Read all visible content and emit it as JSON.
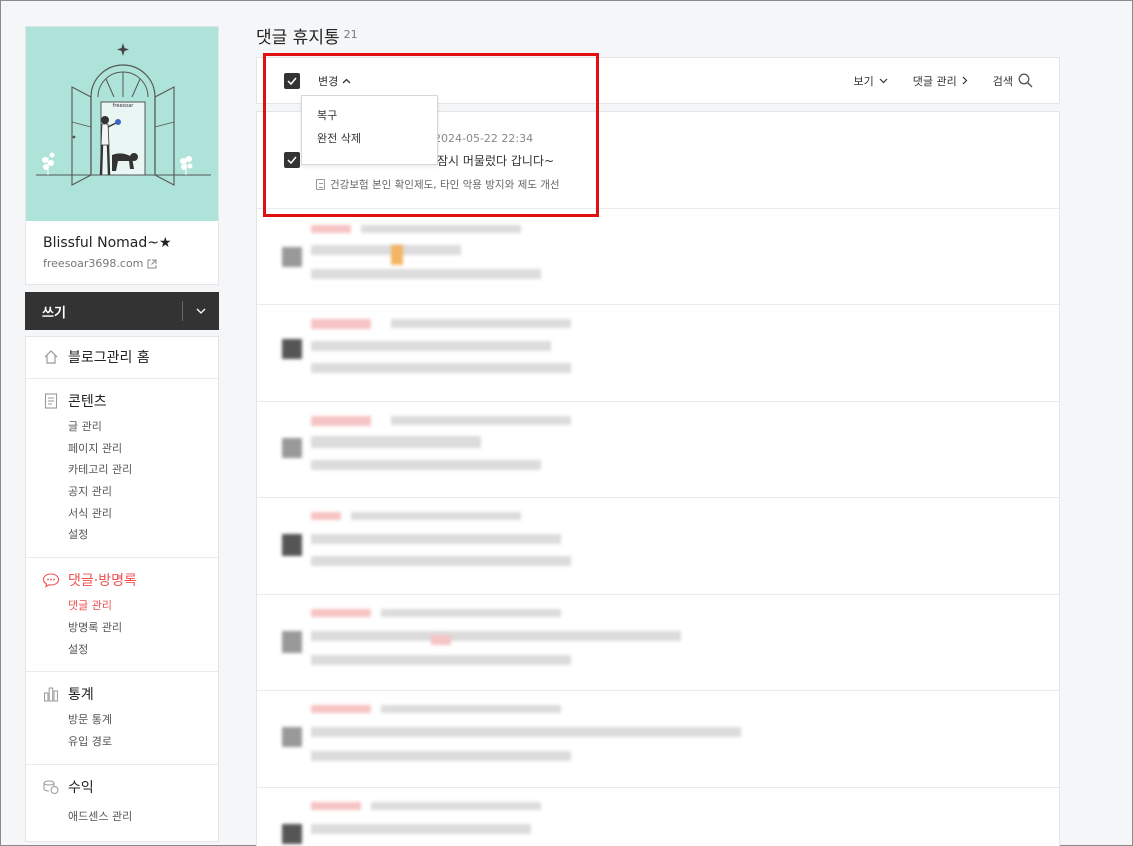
{
  "sidebar": {
    "cover_text": "freesoar",
    "blog_name": "Blissful Nomad~★",
    "blog_url": "freesoar3698.com",
    "write_label": "쓰기",
    "home_label": "블로그관리 홈",
    "content": {
      "label": "콘텐츠",
      "items": [
        "글 관리",
        "페이지 관리",
        "카테고리 관리",
        "공지 관리",
        "서식 관리",
        "설정"
      ]
    },
    "comments": {
      "label": "댓글·방명록",
      "items": [
        "댓글 관리",
        "방명록 관리",
        "설정"
      ]
    },
    "stats": {
      "label": "통계",
      "items": [
        "방문 통계",
        "유입 경로"
      ]
    },
    "revenue": {
      "label": "수익",
      "items": [
        "애드센스 관리"
      ]
    }
  },
  "main": {
    "title": "댓글 휴지통",
    "count": "21",
    "toolbar": {
      "change_label": "변경",
      "view_label": "보기",
      "manage_label": "댓글 관리",
      "search_label": "검색"
    },
    "dropdown": [
      "복구",
      "완전 삭제"
    ],
    "first_comment": {
      "date": "2024-05-22 22:34",
      "text": "잠시 머물렀다 갑니다~",
      "post_title": "건강보험 본인 확인제도, 타인 악용 방지와 제도 개선"
    }
  },
  "colors": {
    "accent": "#f05050",
    "highlight": "#e01010",
    "dark": "#333333"
  }
}
